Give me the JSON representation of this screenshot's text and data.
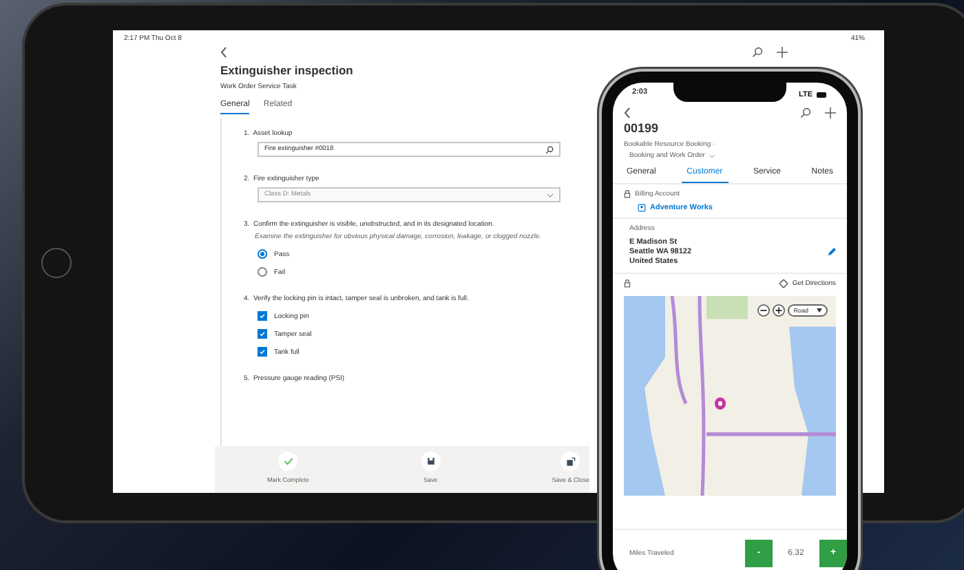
{
  "tablet": {
    "status_bar": {
      "time": "2:17 PM  Thu Oct 8",
      "battery": "41%"
    },
    "title": "Extinguisher inspection",
    "subtitle": "Work Order Service Task",
    "tabs": [
      {
        "label": "General",
        "selected": true
      },
      {
        "label": "Related",
        "selected": false
      }
    ],
    "questions": [
      {
        "kind": "lookup",
        "number": "1.",
        "label": "Asset lookup",
        "value": "Fire extinguisher #0018"
      },
      {
        "kind": "select",
        "number": "2.",
        "label": "Fire extinguisher type",
        "value": "Class D: Metals"
      },
      {
        "kind": "radio",
        "number": "3.",
        "label": "Confirm the extinguisher is visible, unobstructed, and in its designated location.",
        "hint": "Examine the extinguisher for obvious physical damage, corrosion, leakage, or clogged nozzle.",
        "options": [
          {
            "label": "Pass",
            "selected": true
          },
          {
            "label": "Fail",
            "selected": false
          }
        ]
      },
      {
        "kind": "checkbox",
        "number": "4.",
        "label": "Verify the locking pin is intact, tamper seal is unbroken, and tank is full.",
        "options": [
          {
            "label": "Locking pin",
            "checked": true
          },
          {
            "label": "Tamper seal",
            "checked": true
          },
          {
            "label": "Tank full",
            "checked": true
          }
        ]
      },
      {
        "kind": "number",
        "number": "5.",
        "label": "Pressure gauge reading (PSI)"
      }
    ],
    "toolbar": [
      {
        "kind": "check",
        "label": "Mark Complete"
      },
      {
        "kind": "save",
        "label": "Save"
      },
      {
        "kind": "saveclose",
        "label": "Save & Close"
      }
    ]
  },
  "phone": {
    "status_bar": {
      "time": "2:03",
      "network": "LTE"
    },
    "record": "00199",
    "entity": "Bookable Resource Booking ·",
    "form": "Booking and Work Order",
    "tabs": [
      {
        "label": "General",
        "selected": false
      },
      {
        "label": "Customer",
        "selected": true
      },
      {
        "label": "Service",
        "selected": false
      },
      {
        "label": "Notes",
        "selected": false
      }
    ],
    "billing_label": "Billing Account",
    "billing_value": "Adventure Works",
    "address_label": "Address",
    "address_lines": [
      "E Madison St",
      "Seattle WA 98122",
      "United States"
    ],
    "directions": "Get Directions",
    "map_style": "Road",
    "miles_label": "Miles Traveled",
    "minus": "-",
    "miles_value": "6.32",
    "plus": "+"
  }
}
